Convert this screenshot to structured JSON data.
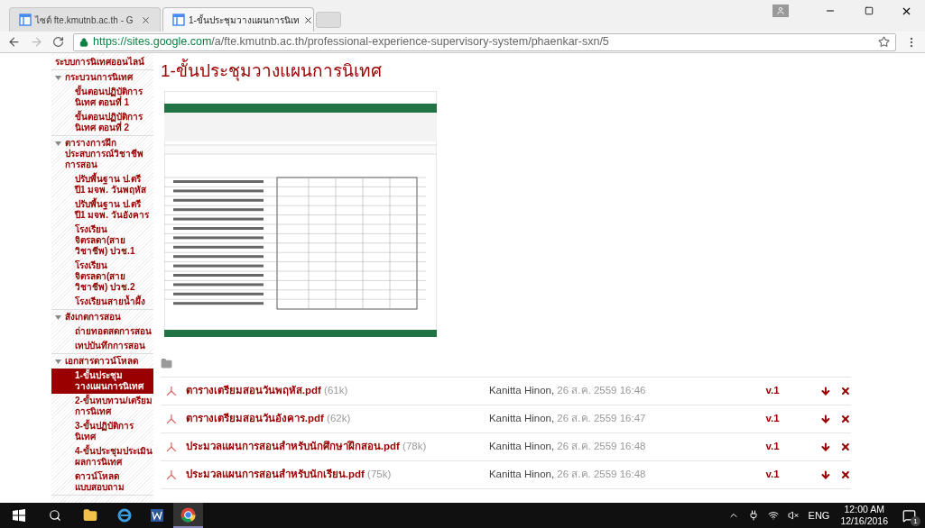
{
  "browser": {
    "tabs": [
      {
        "title": "ไซต์ fte.kmutnb.ac.th - G",
        "selected": false
      },
      {
        "title": "1-ขั้นประชุมวางแผนการนิเท",
        "selected": true
      }
    ],
    "url_host": "https://sites.google.com",
    "url_path": "/a/fte.kmutnb.ac.th/professional-experience-supervisory-system/phaenkar-sxn/5"
  },
  "sidebar": {
    "items": [
      {
        "label": "ระบบการนิเทศออนไลน์",
        "selected": false
      },
      {
        "label": "กระบวนการนิเทศ",
        "expanded": true,
        "selected": false,
        "children": [
          {
            "label": "ขั้นตอนปฏิบัติการนิเทศ ตอนที่ 1",
            "selected": false
          },
          {
            "label": "ขั้นตอนปฏิบัติการนิเทศ ตอนที่ 2",
            "selected": false
          }
        ]
      },
      {
        "label": "ตารางการฝึกประสบการณ์วิชาชีพการสอน",
        "expanded": true,
        "selected": false,
        "children": [
          {
            "label": "ปรับพื้นฐาน ป.ตรี ปี1 มจพ. วันพฤหัส",
            "selected": false
          },
          {
            "label": "ปรับพื้นฐาน ป.ตรี ปี1 มจพ. วันอังคาร",
            "selected": false
          },
          {
            "label": "โรงเรียนจิตรลดา(สายวิชาชีพ) ปวช.1",
            "selected": false
          },
          {
            "label": "โรงเรียนจิตรลดา(สายวิชาชีพ) ปวช.2",
            "selected": false
          },
          {
            "label": "โรงเรียนสายน้ำผึ้ง",
            "selected": false
          }
        ]
      },
      {
        "label": "สังเกตการสอน",
        "expanded": true,
        "selected": false,
        "children": [
          {
            "label": "ถ่ายทอดสดการสอน",
            "selected": false
          },
          {
            "label": "เทปบันทึกการสอน",
            "selected": false
          }
        ]
      },
      {
        "label": "เอกสารดาวน์โหลด",
        "expanded": true,
        "selected": false,
        "children": [
          {
            "label": "1-ขั้นประชุมวางแผนการนิเทศ",
            "selected": true
          },
          {
            "label": "2-ขั้นทบทวน/เตรียมการนิเทศ",
            "selected": false
          },
          {
            "label": "3-ขั้นปฏิบัติการนิเทศ",
            "selected": false
          },
          {
            "label": "4-ขั้นประชุมประเมินผลการนิเทศ",
            "selected": false
          },
          {
            "label": "ดาวน์โหลดแบบสอบถาม",
            "selected": false
          }
        ]
      }
    ]
  },
  "page": {
    "title": "1-ขั้นประชุมวางแผนการนิเทศ"
  },
  "files": [
    {
      "name": "ตารางเตรียมสอนวันพฤหัส.pdf",
      "size": "(61k)",
      "author": "Kanitta Hinon,",
      "date": "26 ส.ค. 2559 16:46",
      "version": "v.1"
    },
    {
      "name": "ตารางเตรียมสอนวันอังคาร.pdf",
      "size": "(62k)",
      "author": "Kanitta Hinon,",
      "date": "26 ส.ค. 2559 16:47",
      "version": "v.1"
    },
    {
      "name": "ประมวลแผนการสอนสำหรับนักศึกษาฝึกสอน.pdf",
      "size": "(78k)",
      "author": "Kanitta Hinon,",
      "date": "26 ส.ค. 2559 16:48",
      "version": "v.1"
    },
    {
      "name": "ประมวลแผนการสอนสำหรับนักเรียน.pdf",
      "size": "(75k)",
      "author": "Kanitta Hinon,",
      "date": "26 ส.ค. 2559 16:48",
      "version": "v.1"
    }
  ],
  "taskbar": {
    "language": "ENG",
    "time": "12:00 AM",
    "date": "12/16/2016",
    "notifications": "1"
  }
}
